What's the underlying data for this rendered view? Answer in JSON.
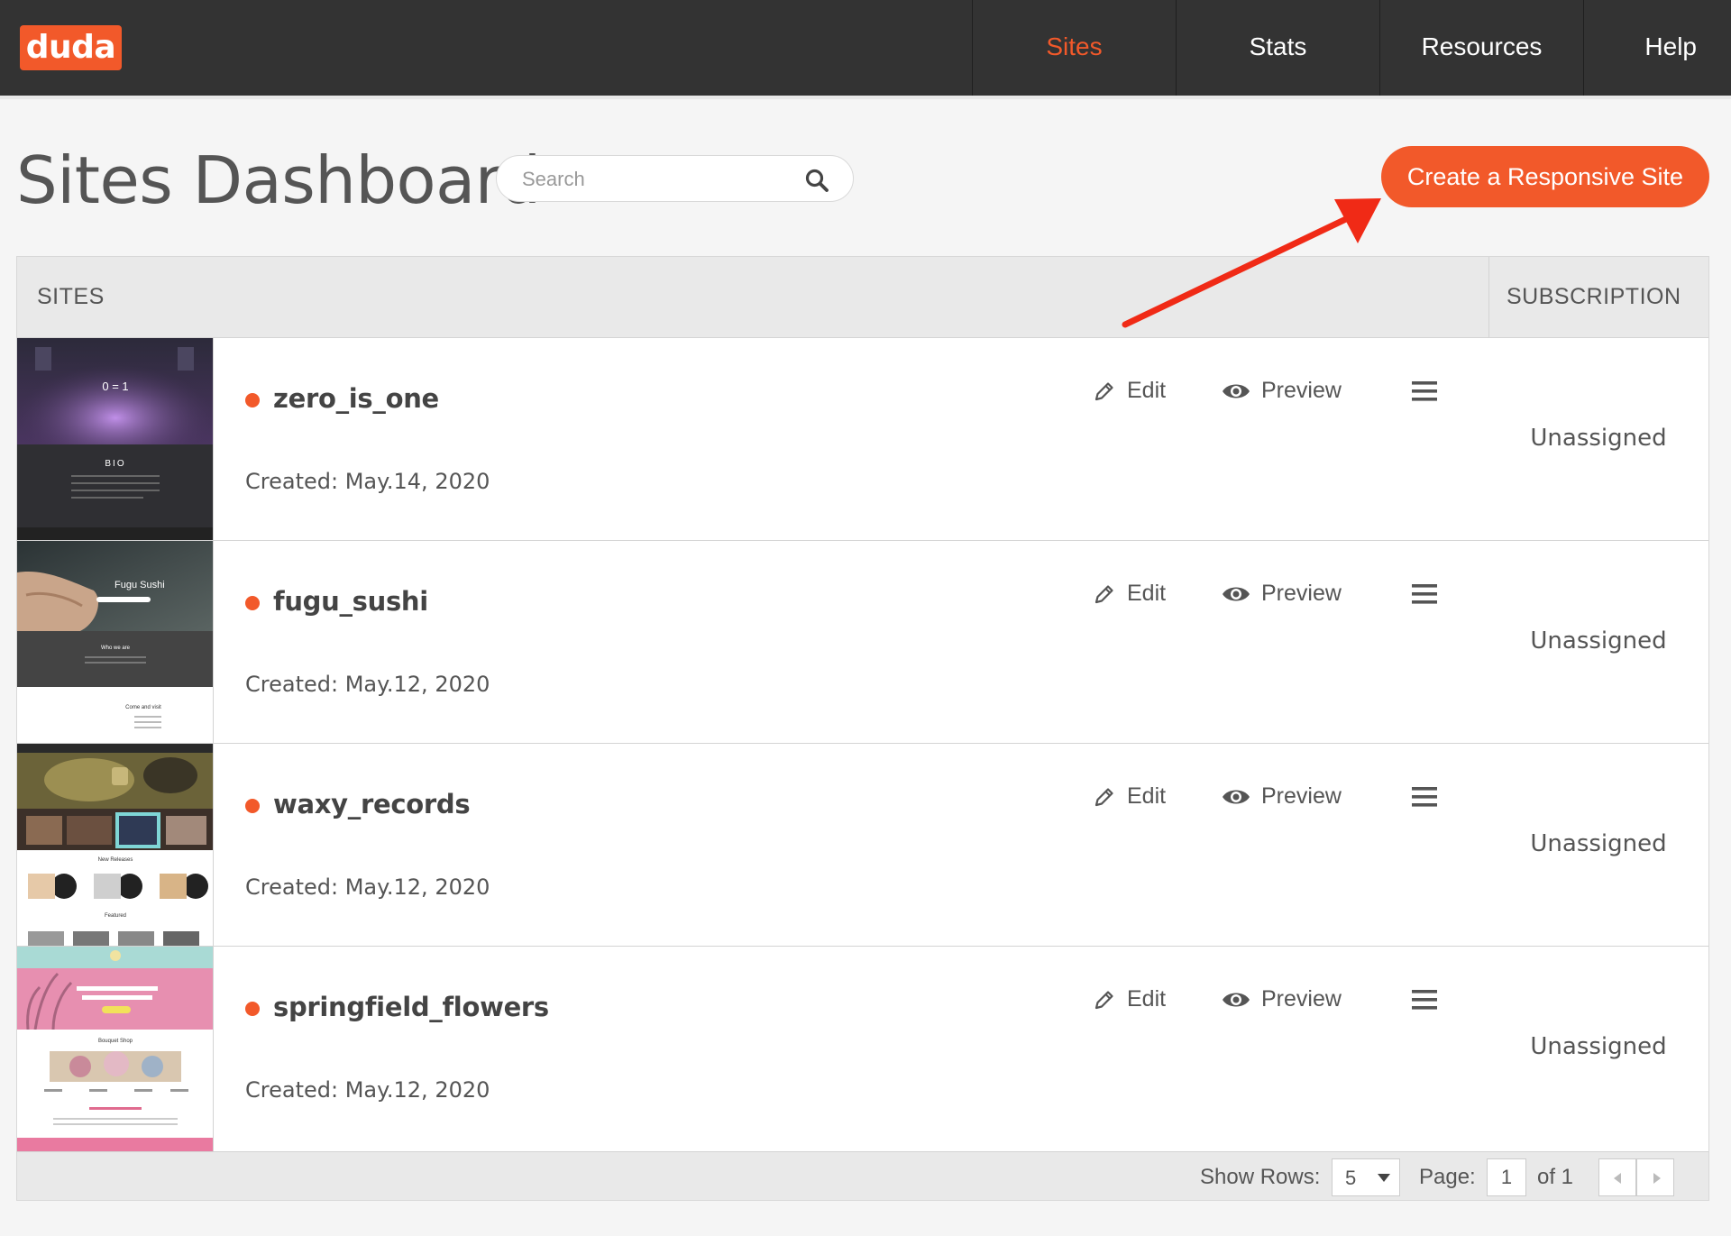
{
  "brand": {
    "logo_text": "duda",
    "accent_color": "#f2592a"
  },
  "nav": {
    "items": [
      {
        "label": "Sites",
        "active": true
      },
      {
        "label": "Stats",
        "active": false
      },
      {
        "label": "Resources",
        "active": false
      },
      {
        "label": "Help",
        "active": false
      }
    ]
  },
  "header": {
    "title": "Sites Dashboard",
    "search_placeholder": "Search",
    "create_button": "Create a Responsive Site"
  },
  "table": {
    "col_sites": "SITES",
    "col_subscription": "SUBSCRIPTION",
    "edit_label": "Edit",
    "preview_label": "Preview",
    "rows": [
      {
        "name": "zero_is_one",
        "created": "Created: May.14, 2020",
        "subscription": "Unassigned",
        "thumb_title": "0 = 1",
        "thumb_section": "BIO"
      },
      {
        "name": "fugu_sushi",
        "created": "Created: May.12, 2020",
        "subscription": "Unassigned",
        "thumb_title": "Fugu Sushi",
        "thumb_section": "Who we are",
        "thumb_subsection": "Come and visit"
      },
      {
        "name": "waxy_records",
        "created": "Created: May.12, 2020",
        "subscription": "Unassigned",
        "thumb_section": "New Releases",
        "thumb_subsection": "Featured"
      },
      {
        "name": "springfield_flowers",
        "created": "Created: May.12, 2020",
        "subscription": "Unassigned",
        "thumb_section": "Bouquet Shop"
      }
    ]
  },
  "footer": {
    "show_rows_label": "Show Rows:",
    "show_rows_value": "5",
    "page_label": "Page:",
    "page_value": "1",
    "page_total": "of 1"
  }
}
